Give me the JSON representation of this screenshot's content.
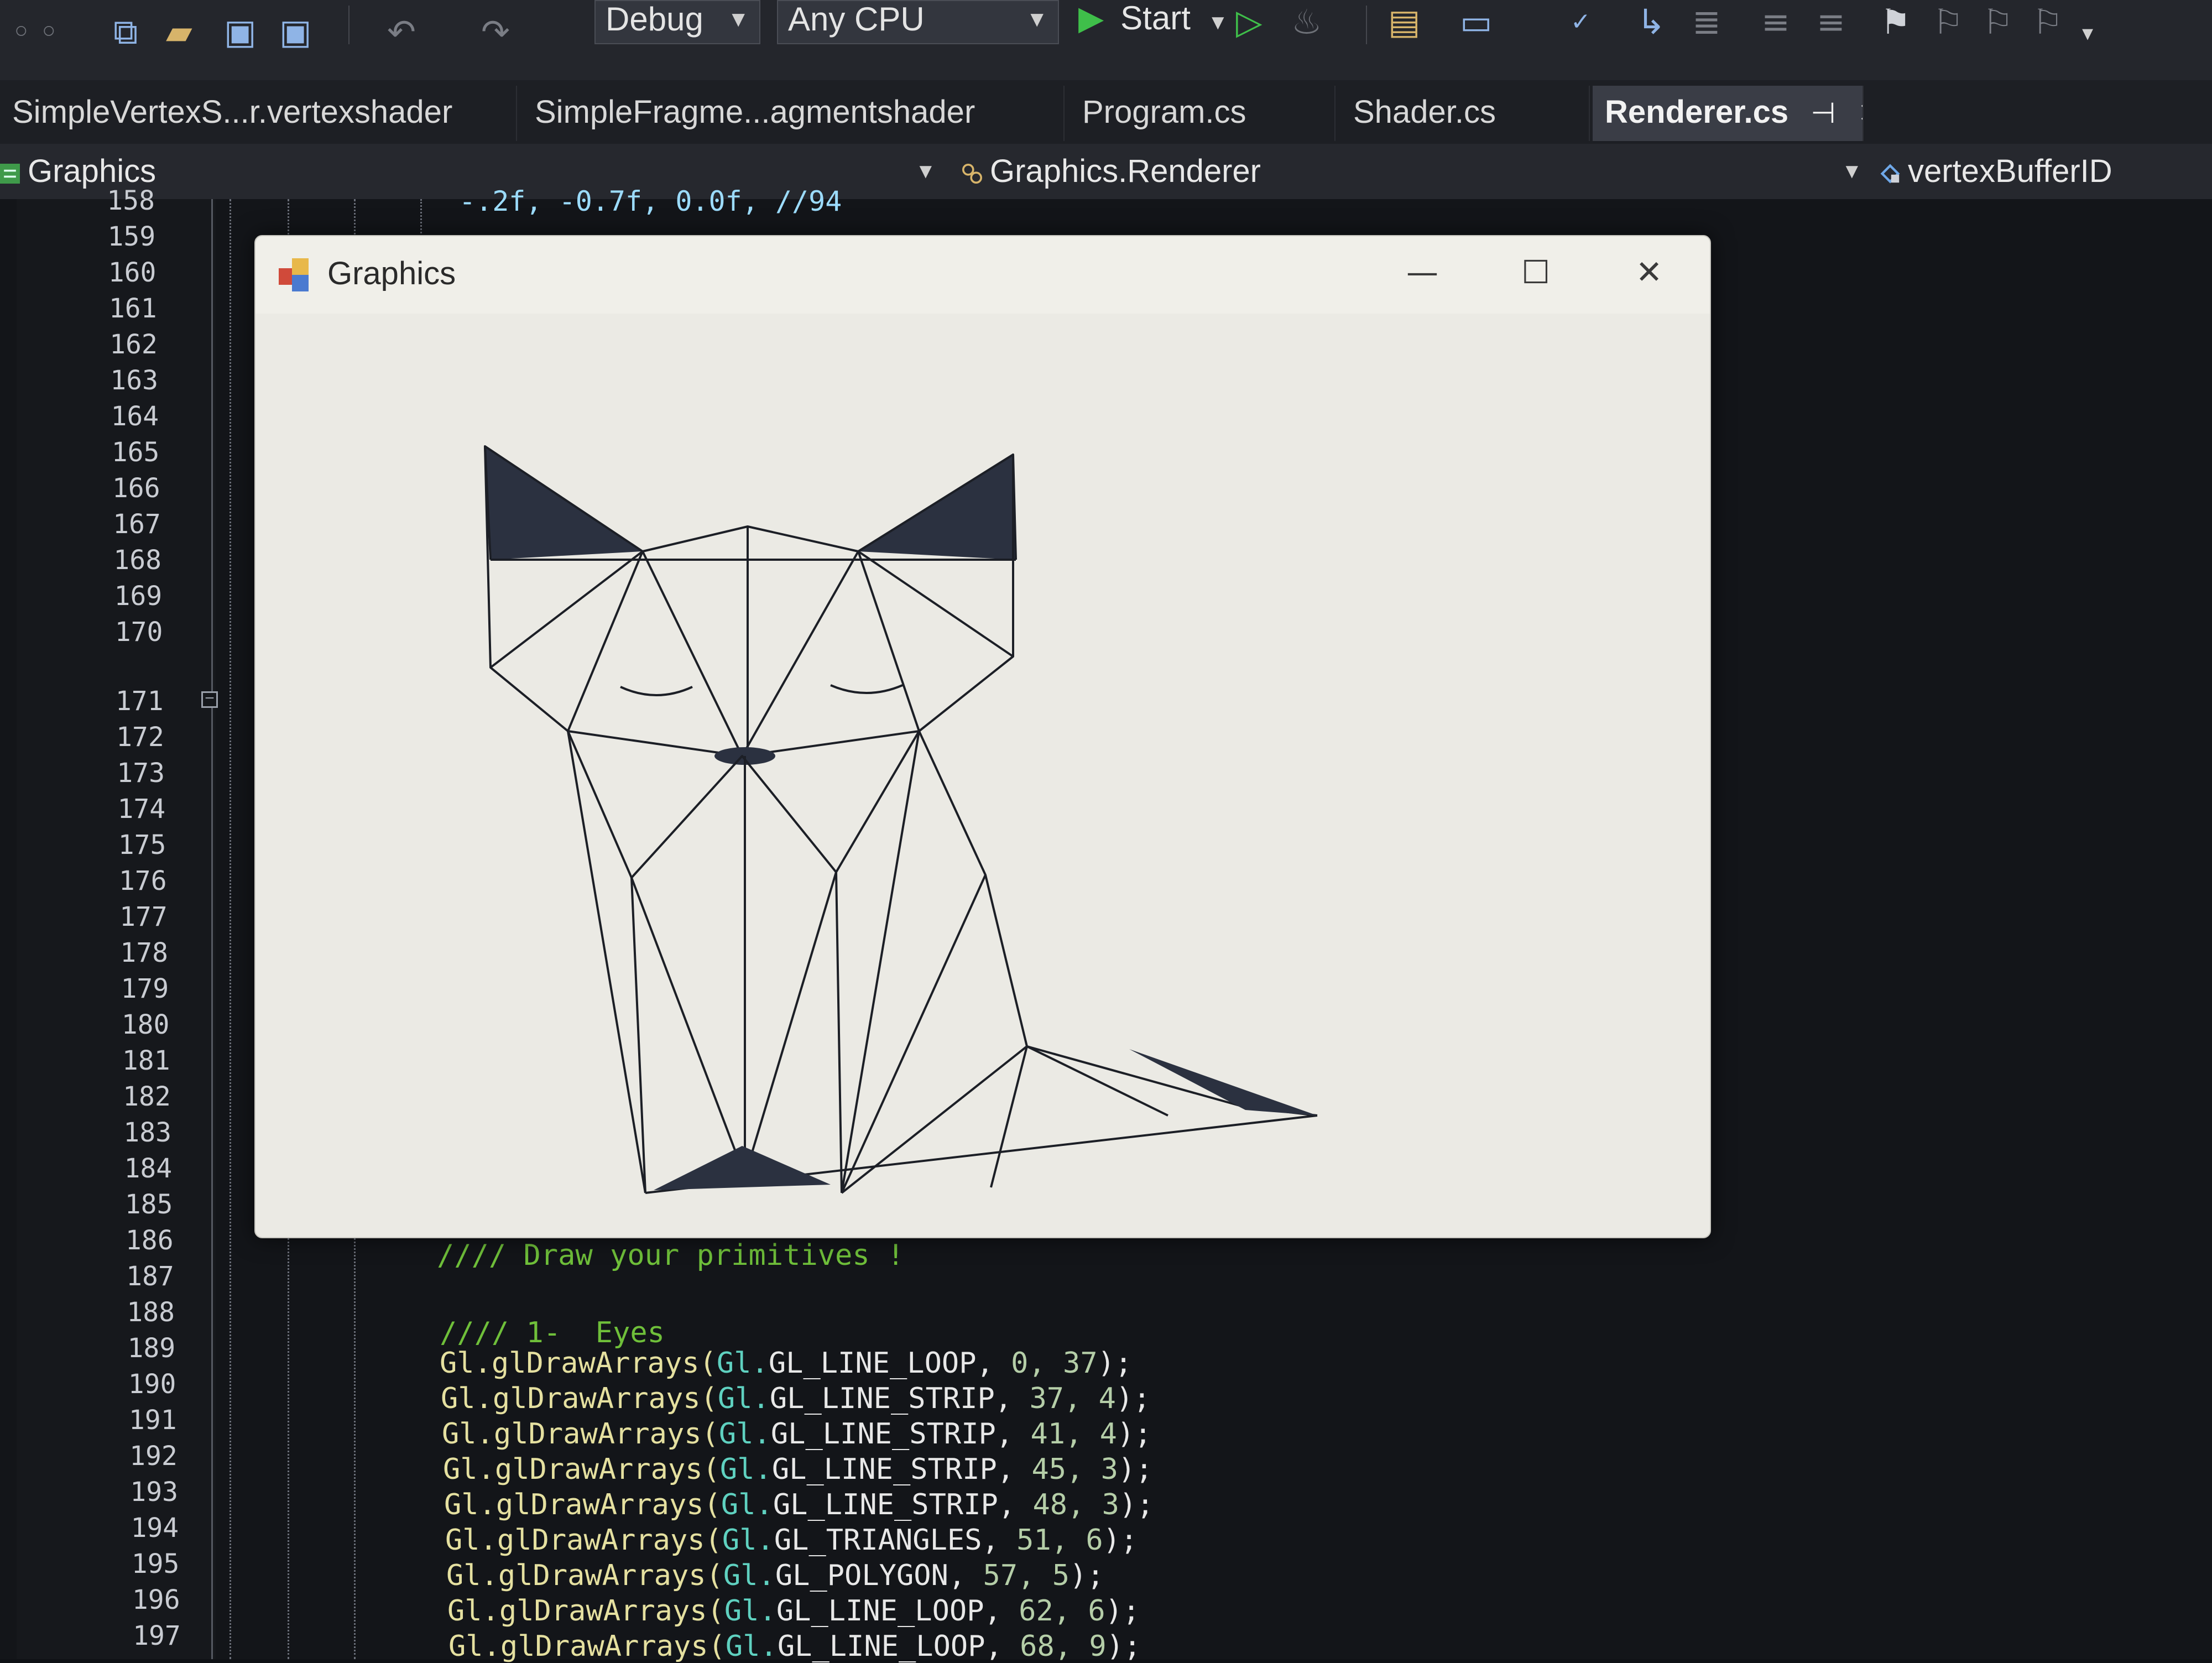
{
  "toolbar": {
    "config": "Debug",
    "platform": "Any CPU",
    "start_label": "Start",
    "icons": [
      "new-project-icon",
      "open-folder-icon",
      "save-icon",
      "save-all-icon",
      "undo-icon",
      "redo-icon",
      "play-icon",
      "play-outline-icon",
      "hot-reload-icon",
      "browse-icon",
      "spellcheck-icon",
      "bookmark-icon"
    ]
  },
  "tabs": [
    {
      "label": "SimpleVertexS...r.vertexshader"
    },
    {
      "label": "SimpleFragme...agmentshader"
    },
    {
      "label": "Program.cs"
    },
    {
      "label": "Shader.cs"
    },
    {
      "label": "Renderer.cs",
      "active": true
    }
  ],
  "navbar": {
    "project": "Graphics",
    "type": "Graphics.Renderer",
    "member": "vertexBufferID"
  },
  "editor": {
    "top_partial": "-.2f, -0.7f, 0.0f, //94",
    "line_numbers": [
      "158",
      "159",
      "160",
      "161",
      "162",
      "163",
      "164",
      "165",
      "166",
      "167",
      "168",
      "169",
      "170",
      "171",
      "172",
      "173",
      "174",
      "175",
      "176",
      "177",
      "178",
      "179",
      "180",
      "181",
      "182",
      "183",
      "184",
      "185",
      "186",
      "187",
      "188",
      "189",
      "190",
      "191",
      "192",
      "193",
      "194",
      "195",
      "196",
      "197"
    ],
    "code": {
      "comment1": "//// Draw your primitives !",
      "comment2": "//// 1-  Eyes",
      "calls": [
        {
          "kind": "GL_LINE_LOOP",
          "args": "0, 37"
        },
        {
          "kind": "GL_LINE_STRIP",
          "args": "37, 4"
        },
        {
          "kind": "GL_LINE_STRIP",
          "args": "41, 4"
        },
        {
          "kind": "GL_LINE_STRIP",
          "args": "45, 3"
        },
        {
          "kind": "GL_LINE_STRIP",
          "args": "48, 3"
        },
        {
          "kind": "GL_TRIANGLES",
          "args": "51, 6"
        },
        {
          "kind": "GL_POLYGON",
          "args": "57, 5"
        },
        {
          "kind": "GL_LINE_LOOP",
          "args": "62, 6"
        },
        {
          "kind": "GL_LINE_LOOP",
          "args": "68, 9"
        }
      ],
      "prefix": "Gl.glDrawArrays(",
      "type_prefix": "Gl."
    }
  },
  "graphics_window": {
    "title": "Graphics",
    "minimize": "—",
    "maximize": "☐",
    "close": "✕"
  },
  "colors": {
    "accent_green": "#3fbf4a",
    "comment": "#6fbf3a",
    "fill_dark": "#2b3140"
  }
}
